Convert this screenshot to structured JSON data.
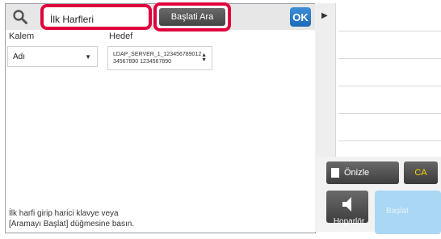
{
  "search": {
    "value": "İlk Harfleri"
  },
  "toolbar": {
    "start_search_label": "Başlati Ara",
    "ok_label": "OK"
  },
  "columns": {
    "kalem_label": "Kalem",
    "hedef_label": "Hedef"
  },
  "kalem_select": {
    "value": "Adı"
  },
  "hedef_select": {
    "value": "LDAP_SERVER_1_12345678901234567890 1234567890"
  },
  "help": {
    "line1": "İlk harfi girip harici klavye veya",
    "line2": "[Aramayı Başlat] düğmesine basın."
  },
  "right_panel": {
    "preview_label": "Önizle",
    "ca_label": "CA",
    "speaker_label": "Hoparlör",
    "start_label": "Başlat"
  },
  "colors": {
    "highlight": "#e0003c",
    "ok_blue": "#1d6ab6",
    "ca_yellow": "#ffd200",
    "start_disabled": "#a9d7f4"
  }
}
